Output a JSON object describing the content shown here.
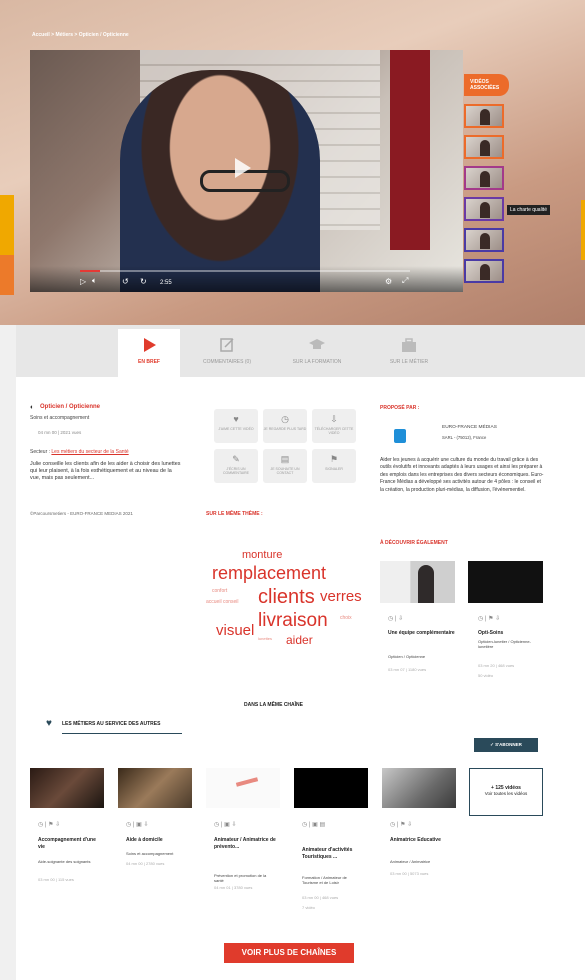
{
  "breadcrumb": "Accueil > Métiers > Opticien / Opticienne",
  "player": {
    "time": "2:55",
    "progress_fraction": 0.06
  },
  "videos_badge": "VIDÉOS ASSOCIÉES",
  "thumb_label": "La charte qualité",
  "tabs": [
    {
      "label": "EN BREF",
      "icon": "play-icon"
    },
    {
      "label": "COMMENTAIRES (0)",
      "icon": "edit-icon"
    },
    {
      "label": "SUR LA FORMATION",
      "icon": "graduation-cap-icon"
    },
    {
      "label": "SUR LE MÉTIER",
      "icon": "briefcase-icon"
    }
  ],
  "job": {
    "title": "Opticien / Opticienne",
    "category": "Soins et accompagnement",
    "date_views": "04 mn 00 | 2021 vues",
    "sector_label": "Secteur :",
    "sector_value": "Les métiers du secteur de la Santé",
    "description": "Julie conseille les clients afin de les aider à choisir des lunettes qui leur plaisent, à la fois esthétiquement et au niveau de la vue, mais pas seulement...",
    "copyright": "©Parcoursmetiers - EURO-FRANCE MEDIAS 2021"
  },
  "stats": [
    {
      "label": "J'AIME CETTE VIDÉO",
      "icon": "heart-icon"
    },
    {
      "label": "JE REGARDE PLUS TARD",
      "icon": "clock-icon"
    },
    {
      "label": "TÉLÉCHARGER CETTE VIDÉO",
      "icon": "download-icon"
    },
    {
      "label": "J'ÉCRIS UN COMMENTAIRE",
      "icon": "pen-icon"
    },
    {
      "label": "JE SOUHAITE UN CONTACT",
      "icon": "document-icon"
    },
    {
      "label": "SIGNALER",
      "icon": "flag-icon"
    }
  ],
  "same_theme": "SUR LE MÊME THÈME :",
  "word_cloud": [
    {
      "word": "monture"
    },
    {
      "word": "remplacement"
    },
    {
      "word": "clients"
    },
    {
      "word": "verres"
    },
    {
      "word": "livraison"
    },
    {
      "word": "visuel"
    },
    {
      "word": "aider"
    },
    {
      "word": "confort"
    },
    {
      "word": "accueil conseil"
    },
    {
      "word": "choix"
    },
    {
      "word": "lunettes"
    }
  ],
  "proposed_by": {
    "heading": "PROPOSÉ PAR :",
    "org": "EURO-FRANCE MÉDIAS",
    "org_id": "SARL - (75012), France",
    "description": "Aider les jeunes à acquérir une culture du monde du travail grâce à des outils évolutifs et innovants adaptés à leurs usages et ainsi les préparer à des emplois dans les entreprises des divers secteurs économiques. Euro-France Médias a développé ses activités autour de 4 pôles : le conseil et la création, la production pluri-médias, la diffusion, l'événementiel."
  },
  "discover": {
    "heading": "À DÉCOUVRIR ÉGALEMENT",
    "items": [
      {
        "title": "Une équipe complémentaire",
        "sub": "Opticien / Opticienne",
        "meta": "03 mn 07 | 1180 vues"
      },
      {
        "title": "Opti-Soins",
        "sub": "Opticien-lunetier / Opticienne-lunetière",
        "meta": "03 mn 20 | 468 vues",
        "extra": "50 vidéo"
      }
    ]
  },
  "chain": {
    "heading": "DANS LA MÊME CHAÎNE",
    "title": "LES MÉTIERS AU SERVICE DES AUTRES",
    "subscribe": "S'ABONNER",
    "more_videos_count": "+ 125 vidéos",
    "more_videos_label": "Voir toutes les vidéos",
    "items": [
      {
        "title": "Accompagnement d'une vie",
        "sub": "Aide-soignante des soignants",
        "meta": "03 mn 00 | 115 vues"
      },
      {
        "title": "Aide à domicile",
        "sub": "Soins et accompagnement",
        "meta": "04 mn 00 | 2780 vues"
      },
      {
        "title": "Animateur / Animatrice de prévento...",
        "sub": "Prévention et promotion de la santé",
        "meta": "04 mn 01 | 3780 vues"
      },
      {
        "title": "Animateur d'activités Touristiques ...",
        "sub": "Formation / Animateur de Tourisme et de Loisir",
        "meta": "03 mn 00 | 468 vues",
        "extra": "7 vidéo"
      },
      {
        "title": "Animatrice Educative",
        "sub": "Animateur / Animatrice",
        "meta": "03 mn 00 | 5073 vues"
      }
    ]
  },
  "more_chains": "VOIR PLUS DE CHAÎNES"
}
